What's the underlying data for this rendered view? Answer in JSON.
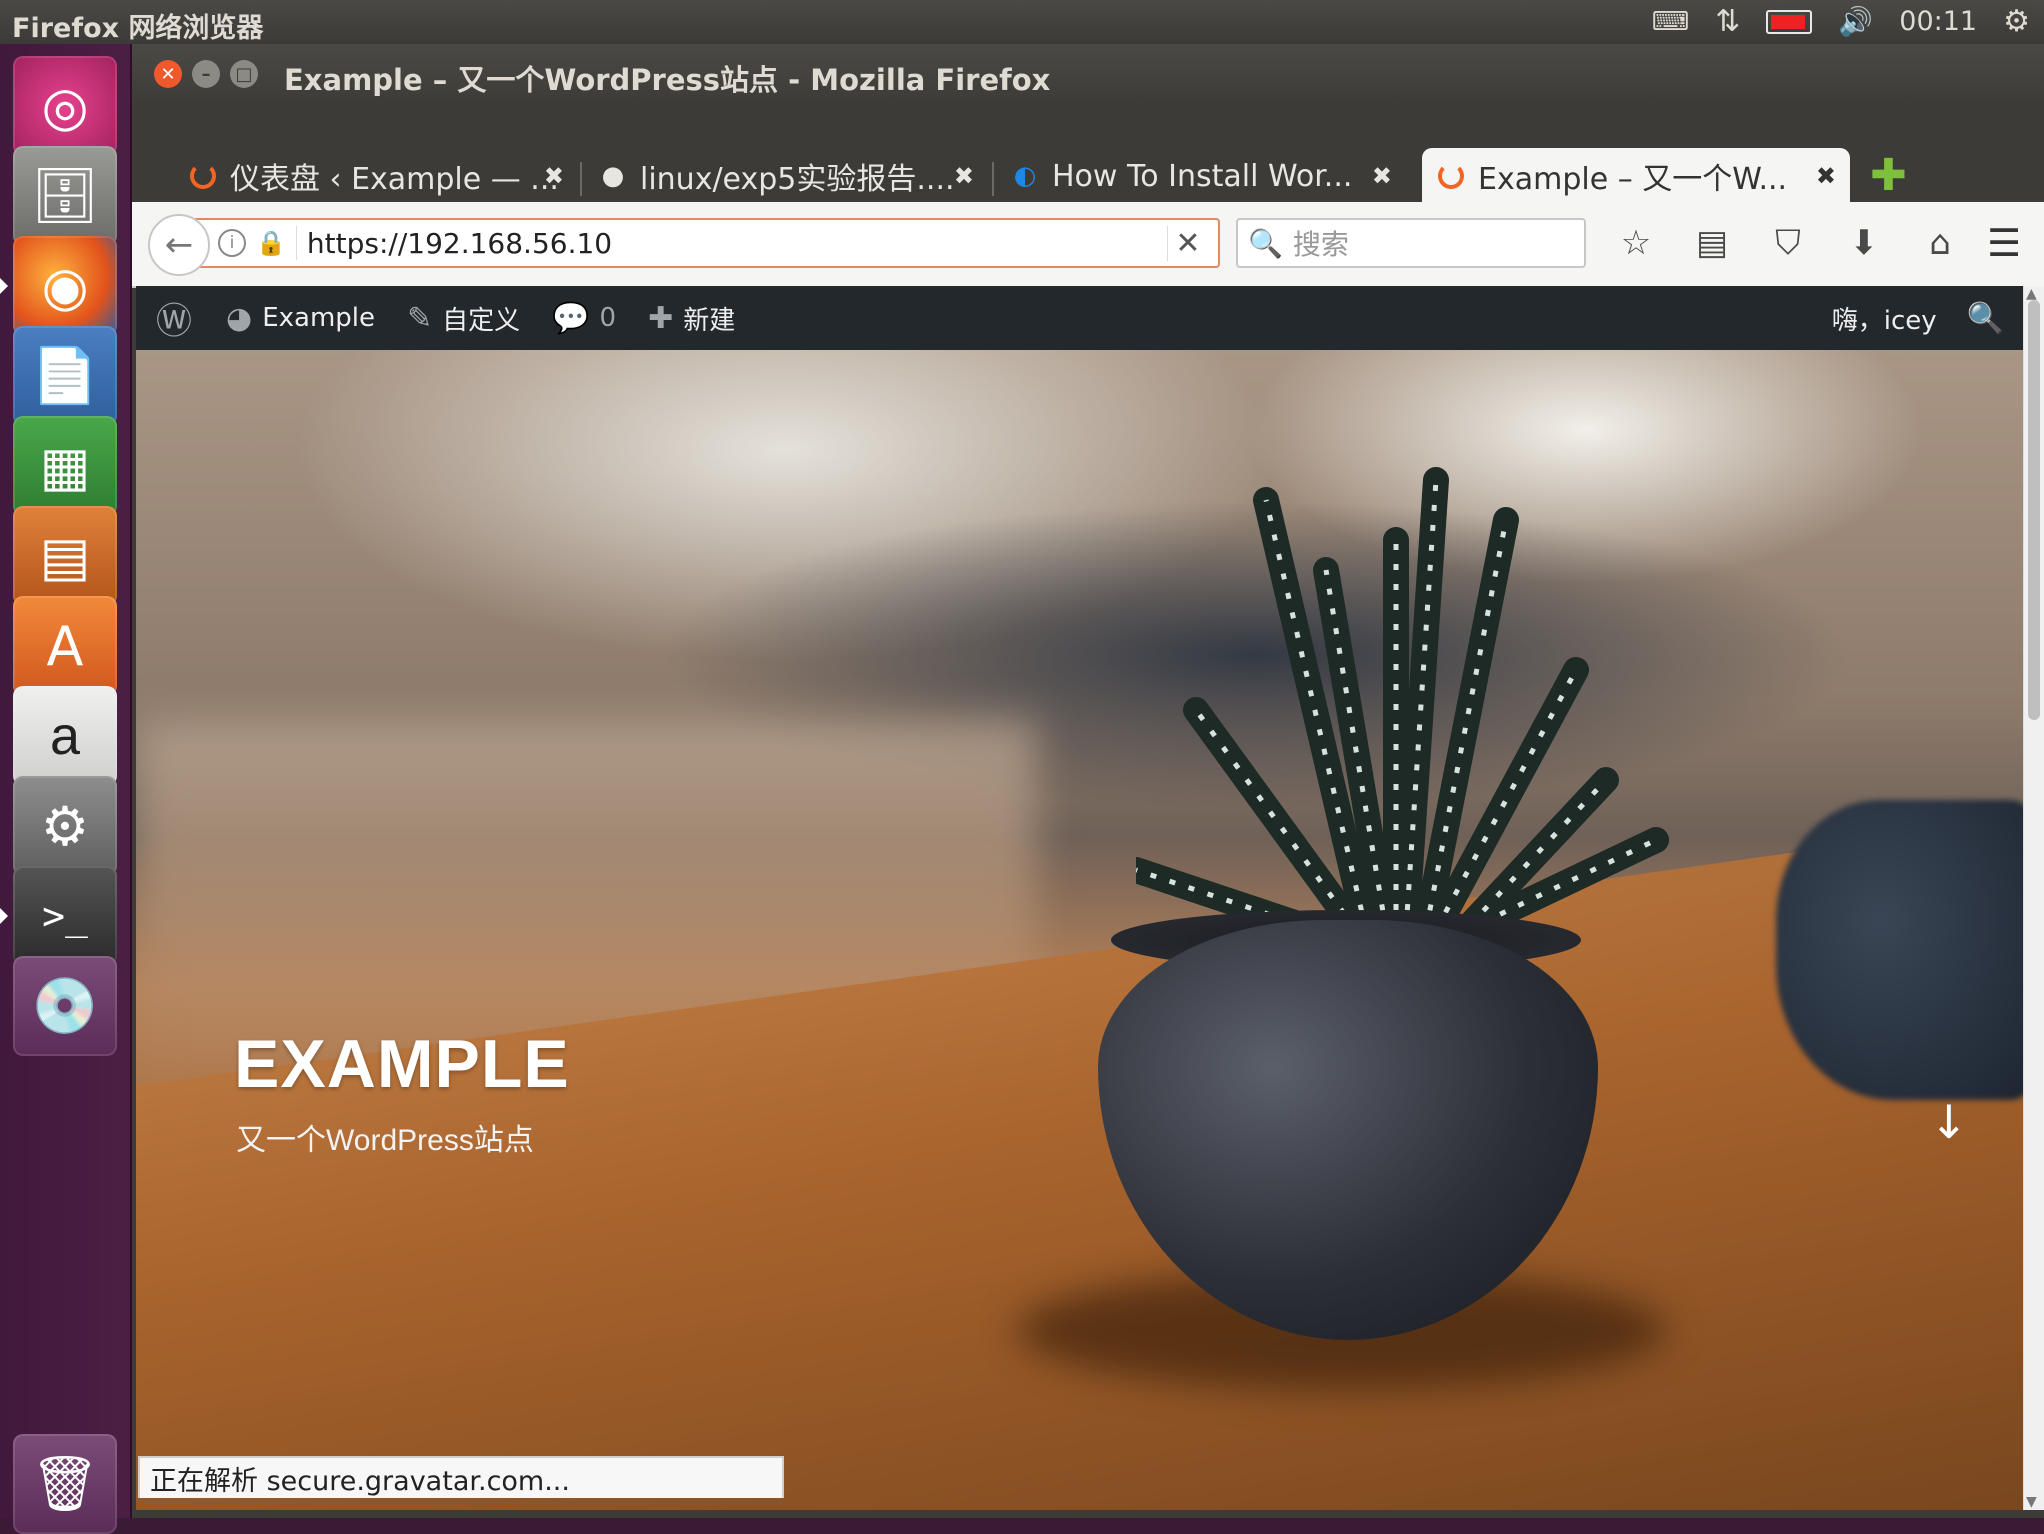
{
  "top_panel": {
    "app_name": "Firefox 网络浏览器",
    "clock": "00:11",
    "icons": [
      "keyboard-icon",
      "network-icon",
      "battery-icon",
      "volume-icon",
      "power-icon"
    ]
  },
  "launcher": {
    "items": [
      "ubuntu-dash",
      "files",
      "firefox",
      "libreoffice-writer",
      "libreoffice-calc",
      "libreoffice-impress",
      "ubuntu-software",
      "amazon",
      "system-settings",
      "terminal",
      "dvd",
      "trash"
    ]
  },
  "window": {
    "title": "Example – 又一个WordPress站点 - Mozilla Firefox"
  },
  "tabs": [
    {
      "label": "仪表盘 ‹ Example — ...",
      "icon": "loading-icon"
    },
    {
      "label": "linux/exp5实验报告....",
      "icon": "github-icon"
    },
    {
      "label": "How To Install Wor...",
      "icon": "digitalocean-icon"
    },
    {
      "label": "Example – 又一个W...",
      "icon": "loading-icon",
      "active": true
    }
  ],
  "navbar": {
    "url": "https://192.168.56.10",
    "search_placeholder": "搜索"
  },
  "wp_admin_bar": {
    "site_name": "Example",
    "customize": "自定义",
    "comments_count": "0",
    "new": "新建",
    "greeting": "嗨，icey"
  },
  "hero": {
    "site_title": "EXAMPLE",
    "tagline": "又一个WordPress站点"
  },
  "status_bar": {
    "text": "正在解析 secure.gravatar.com..."
  }
}
